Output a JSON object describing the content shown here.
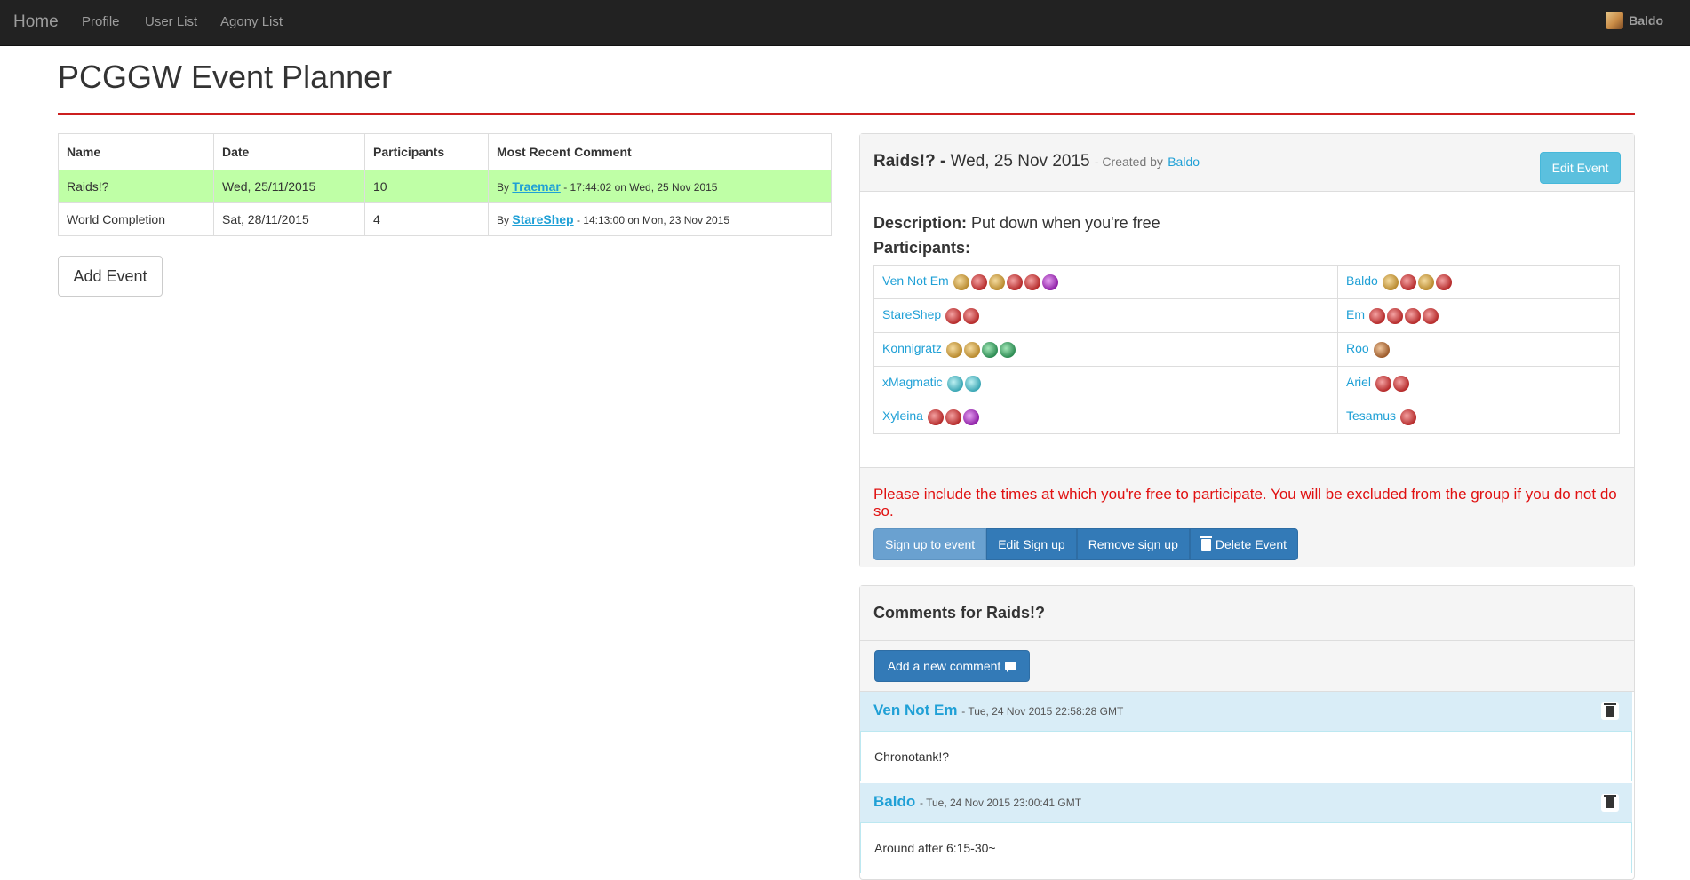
{
  "nav": {
    "brand": "Home",
    "links": [
      "Profile",
      "User List",
      "Agony List"
    ],
    "user": "Baldo"
  },
  "page": {
    "title": "PCGGW Event Planner"
  },
  "events_table": {
    "headers": [
      "Name",
      "Date",
      "Participants",
      "Most Recent Comment"
    ],
    "rows": [
      {
        "name": "Raids!?",
        "date": "Wed, 25/11/2015",
        "participants": "10",
        "by": "By",
        "author": "Traemar",
        "when": "- 17:44:02 on Wed, 25 Nov 2015"
      },
      {
        "name": "World Completion",
        "date": "Sat, 28/11/2015",
        "participants": "4",
        "by": "By",
        "author": "StareShep",
        "when": "- 14:13:00 on Mon, 23 Nov 2015"
      }
    ]
  },
  "add_event_label": "Add Event",
  "event": {
    "name": "Raids!? -",
    "date": "Wed, 25 Nov 2015",
    "created_prefix": "- Created by",
    "creator": "Baldo",
    "edit_label": "Edit Event",
    "description_label": "Description:",
    "description": "Put down when you're free",
    "participants_label": "Participants:",
    "participants": [
      {
        "left": "Ven Not Em",
        "left_icons": [
          "gold",
          "red",
          "gold",
          "red",
          "red",
          "pur"
        ],
        "right": "Baldo",
        "right_icons": [
          "gold",
          "red",
          "gold",
          "red"
        ]
      },
      {
        "left": "StareShep",
        "left_icons": [
          "red",
          "red"
        ],
        "right": "Em",
        "right_icons": [
          "red",
          "red",
          "red",
          "red"
        ]
      },
      {
        "left": "Konnigratz",
        "left_icons": [
          "gold",
          "gold",
          "grn",
          "grn"
        ],
        "right": "Roo",
        "right_icons": [
          "brn"
        ]
      },
      {
        "left": "xMagmatic",
        "left_icons": [
          "cyn",
          "cyn"
        ],
        "right": "Ariel",
        "right_icons": [
          "red",
          "red"
        ]
      },
      {
        "left": "Xyleina",
        "left_icons": [
          "red",
          "red",
          "pur"
        ],
        "right": "Tesamus",
        "right_icons": [
          "red"
        ]
      }
    ],
    "warning": "Please include the times at which you're free to participate. You will be excluded from the group if you do not do so.",
    "buttons": [
      "Sign up to event",
      "Edit Sign up",
      "Remove sign up",
      "Delete Event"
    ]
  },
  "comments": {
    "title": "Comments for Raids!?",
    "add_label": "Add a new comment",
    "items": [
      {
        "author": "Ven Not Em",
        "time": "- Tue, 24 Nov 2015 22:58:28 GMT",
        "text": "Chronotank!?"
      },
      {
        "author": "Baldo",
        "time": "- Tue, 24 Nov 2015 23:00:41 GMT",
        "text": "Around after 6:15-30~"
      }
    ]
  }
}
